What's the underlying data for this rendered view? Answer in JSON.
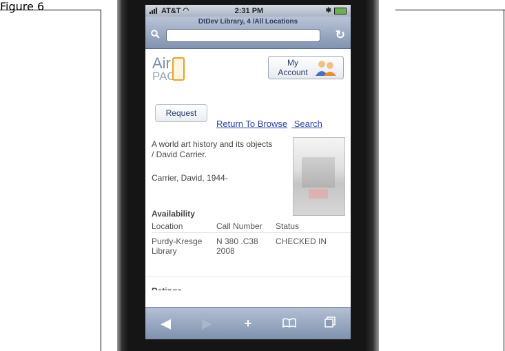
{
  "doc": {
    "caption": "Figure 6"
  },
  "status_bar": {
    "carrier": "AT&T",
    "time": "2:31 PM"
  },
  "browser": {
    "page_title": "DtDev Library, 4 /All Locations",
    "address_value": ""
  },
  "app": {
    "logo_line1": "Air",
    "logo_line2": "PAC",
    "account_button": {
      "line1": "My",
      "line2": "Account"
    }
  },
  "record": {
    "request_label": "Request",
    "return_link": "Return To Browse",
    "search_link": "Search",
    "title": "A world art history and its objects / David Carrier.",
    "author": "Carrier, David, 1944-",
    "availability_heading": "Availability",
    "columns": [
      "Location",
      "Call Number",
      "Status"
    ],
    "rows": [
      {
        "location": "Purdy-Kresge Library",
        "call_number": "N 380 .C38 2008",
        "status": "CHECKED IN"
      }
    ],
    "next_section_partial": "Ratings"
  },
  "toolbar": {
    "back": "back-arrow-icon",
    "forward": "forward-arrow-icon",
    "add": "plus-icon",
    "bookmarks": "bookmarks-icon",
    "pages": "pages-icon"
  }
}
